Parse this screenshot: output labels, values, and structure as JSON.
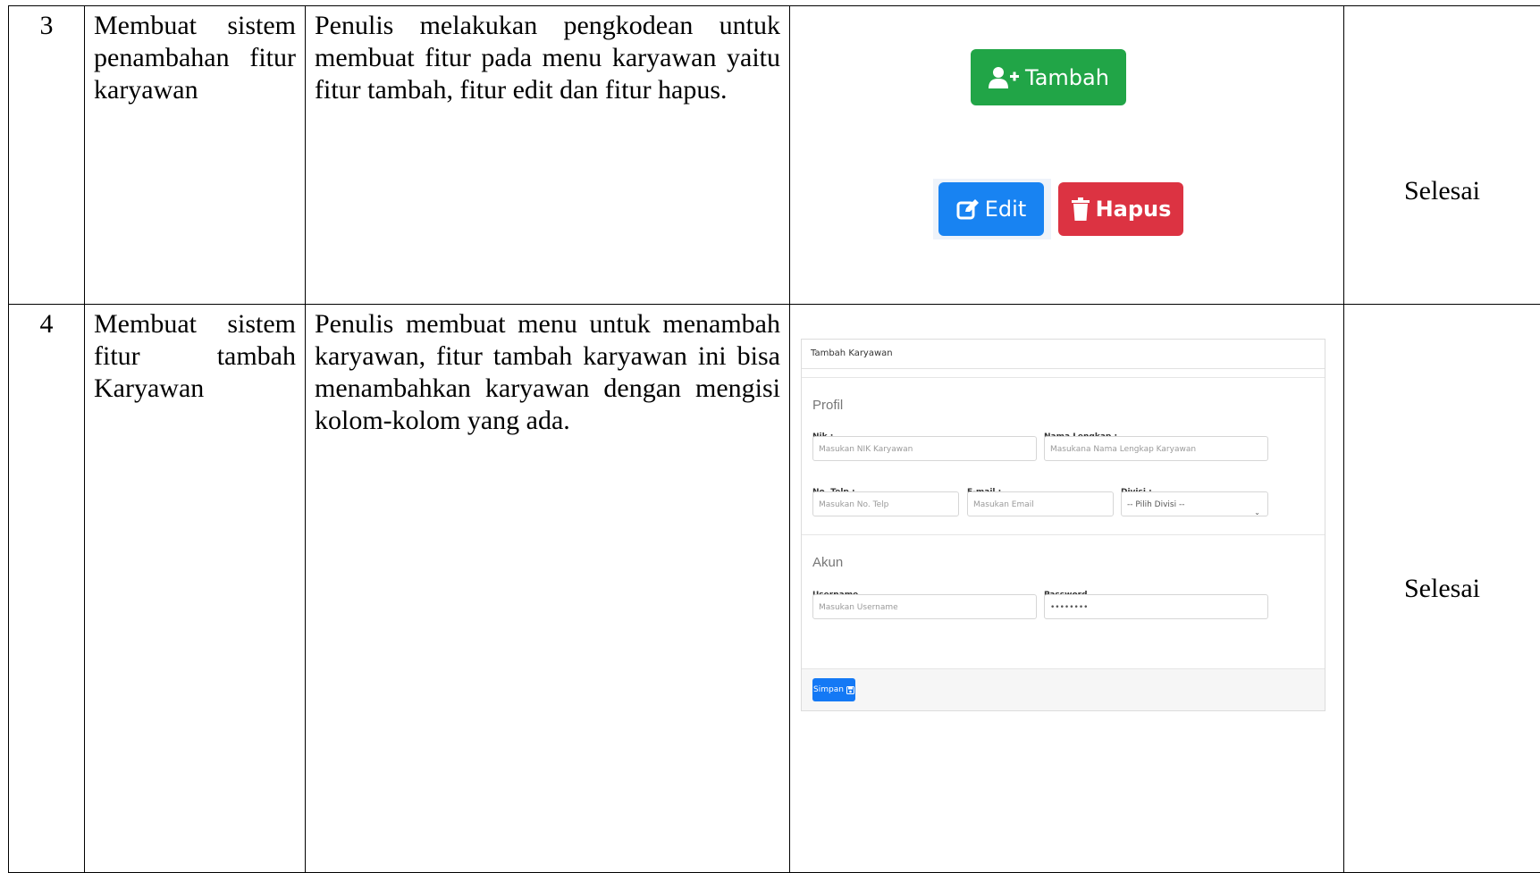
{
  "rows": [
    {
      "no": "3",
      "activity": "Membuat sistem penambahan fitur karyawan",
      "description": "Penulis melakukan pengkodean untuk membuat fitur pada menu karyawan yaitu fitur tambah, fitur edit dan fitur hapus.",
      "status": "Selesai",
      "buttons": {
        "add_label": "Tambah",
        "edit_label": "Edit",
        "delete_label": "Hapus"
      }
    },
    {
      "no": "4",
      "activity": "Membuat sistem fitur tambah Karyawan",
      "description": "Penulis membuat menu untuk menambah karyawan, fitur tambah karyawan ini bisa menambahkan karyawan dengan mengisi kolom-kolom yang ada.",
      "status": "Selesai",
      "form": {
        "title": "Tambah Karyawan",
        "profile_section": "Profil",
        "nik_label": "Nik :",
        "nik_placeholder": "Masukan NIK Karyawan",
        "name_label": "Nama Lengkap :",
        "name_placeholder": "Masukana Nama Lengkap Karyawan",
        "phone_label": "No. Telp :",
        "phone_placeholder": "Masukan No. Telp",
        "email_label": "E-mail :",
        "email_placeholder": "Masukan Email",
        "division_label": "Divisi :",
        "division_selected": "-- Pilih Divisi --",
        "account_section": "Akun",
        "username_label": "Username",
        "username_placeholder": "Masukan Username",
        "password_label": "Password",
        "password_value": "••••••••",
        "save_label": "Simpan"
      }
    }
  ],
  "colors": {
    "green": "#21a547",
    "blue": "#1883f2",
    "red": "#dc3342",
    "form_blue": "#1479f5"
  }
}
